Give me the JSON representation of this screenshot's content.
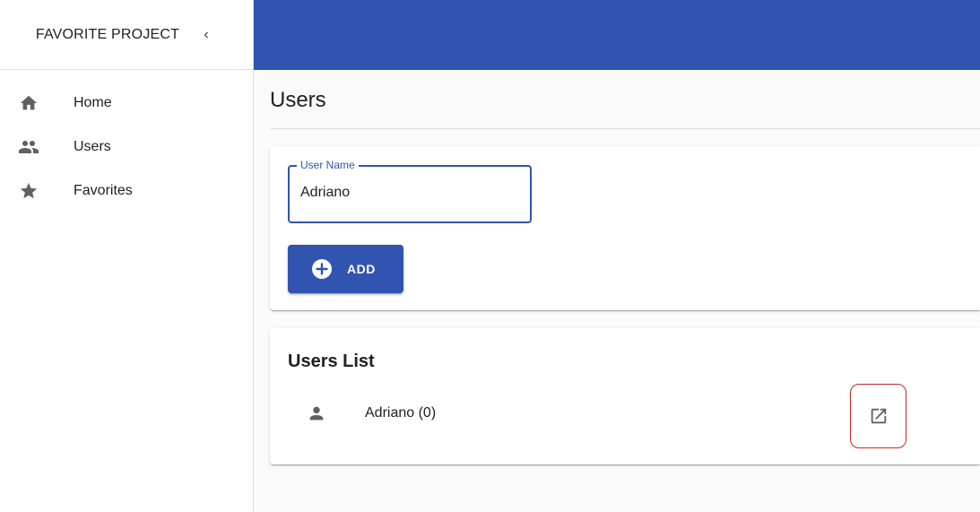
{
  "sidebar": {
    "title": "FAVORITE PROJECT",
    "collapse_icon": "chevron-left-icon",
    "items": [
      {
        "label": "Home",
        "icon": "home-icon"
      },
      {
        "label": "Users",
        "icon": "people-icon"
      },
      {
        "label": "Favorites",
        "icon": "star-icon"
      }
    ]
  },
  "topbar": {
    "color": "#3054b0"
  },
  "main": {
    "title": "Users",
    "form": {
      "field_label": "User Name",
      "field_value": "Adriano",
      "add_label": "ADD",
      "add_icon": "add-circle-icon"
    },
    "list": {
      "title": "Users List",
      "items": [
        {
          "label": "Adriano (0)",
          "icon": "person-icon",
          "action_icon": "open-in-new-icon"
        }
      ]
    }
  },
  "colors": {
    "accent": "#3054b0",
    "highlight": "#c62828"
  }
}
